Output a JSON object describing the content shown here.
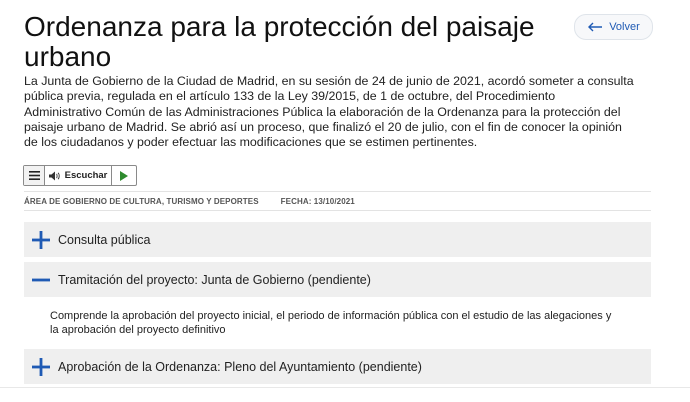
{
  "page": {
    "title": "Ordenanza para la protección del paisaje urbano",
    "back_label": "Volver",
    "intro": "La Junta de Gobierno de la Ciudad de Madrid, en su sesión de 24 de junio de 2021, acordó someter a consulta pública previa, regulada en el artículo 133 de la Ley 39/2015, de 1 de octubre, del Procedimiento Administrativo Común de las Administraciones Pública la elaboración de la Ordenanza para la protección del paisaje urbano de Madrid. Se abrió así un proceso, que finalizó el 20 de julio, con el fin de conocer la opinión de los ciudadanos y poder efectuar las modificaciones que se estimen pertinentes."
  },
  "player": {
    "listen_label": "Escuchar"
  },
  "meta": {
    "area": "ÁREA DE GOBIERNO DE CULTURA, TURISMO Y DEPORTES",
    "date": "FECHA: 13/10/2021"
  },
  "accordion": [
    {
      "label": "Consulta pública",
      "expanded": false
    },
    {
      "label": "Tramitación del proyecto: Junta de Gobierno (pendiente)",
      "expanded": true,
      "body": "Comprende la aprobación del proyecto inicial, el periodo de información pública con el estudio de las alegaciones y la aprobación del proyecto definitivo"
    },
    {
      "label": "Aprobación de la Ordenanza: Pleno del Ayuntamiento (pendiente)",
      "expanded": false
    }
  ],
  "colors": {
    "accent": "#1f5ab4",
    "panel": "#efefef"
  }
}
